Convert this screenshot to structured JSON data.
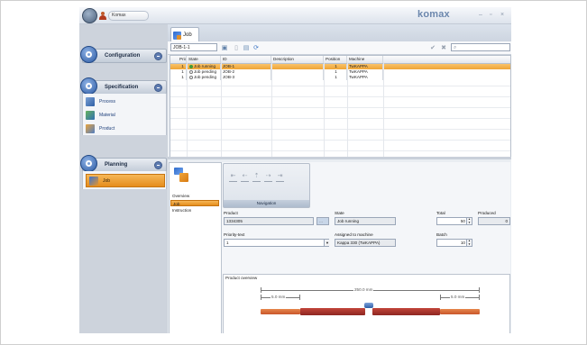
{
  "window": {
    "user": "Komax",
    "brand": "komax",
    "controls": [
      "–",
      "▫",
      "×"
    ]
  },
  "sidebar": {
    "sections": [
      {
        "label": "Configuration",
        "items": []
      },
      {
        "label": "Specification",
        "items": [
          "Process",
          "Material",
          "Product"
        ]
      },
      {
        "label": "Planning",
        "items": [
          "Job"
        ],
        "active_item": "Job"
      }
    ]
  },
  "content": {
    "tab_label": "Job",
    "toolbar": {
      "job_value": "JOB-1-1"
    },
    "grid": {
      "columns": [
        "Prio...",
        "State",
        "ID",
        "Description",
        "Position",
        "Machine"
      ],
      "rows": [
        {
          "prio": "1",
          "state": "Job running",
          "id": "JOB-1",
          "description": "",
          "position": "1",
          "machine": "TwKAPPA",
          "selected": true
        },
        {
          "prio": "1",
          "state": "Job pending",
          "id": "JOB-2",
          "description": "",
          "position": "1",
          "machine": "TwKAPPA",
          "selected": false
        },
        {
          "prio": "1",
          "state": "Job pending",
          "id": "JOB-3",
          "description": "",
          "position": "1",
          "machine": "TwKAPPA",
          "selected": false
        }
      ]
    },
    "detail": {
      "nav_items": [
        "Overview",
        "Job",
        "Instruction"
      ],
      "active_nav": "Job",
      "navigation_label": "Navigation",
      "product_label": "Product",
      "product_value": "1334305",
      "state_label": "State",
      "state_value": "Job running",
      "total_label": "Total",
      "total_value": "50",
      "produced_label": "Produced",
      "produced_value": "0",
      "priority_label": "Priority-text",
      "priority_value": "1",
      "machine_label": "Assigned to machine",
      "machine_value": "Kappa 330 (TwKAPPA)",
      "batch_label": "Batch",
      "batch_value": "10",
      "overview_label": "Product overview",
      "overview_total_length": "250.0 mm",
      "overview_left_strip": "5.0 mm",
      "overview_right_strip": "5.0 mm",
      "cable_color": "#c9562b"
    }
  }
}
